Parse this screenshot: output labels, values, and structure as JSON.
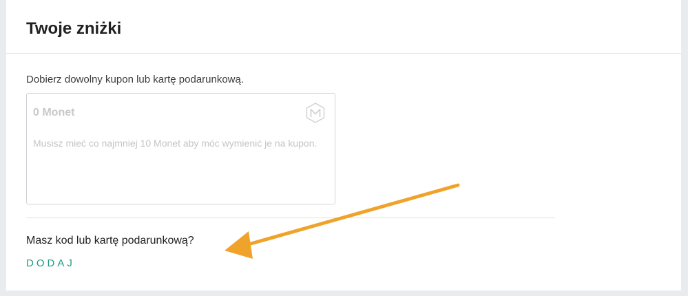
{
  "panel": {
    "title": "Twoje zniżki",
    "hint": "Dobierz dowolny kupon lub kartę podarunkową."
  },
  "coupon": {
    "amount": "0 Monet",
    "logo_icon": "monet-hexagon-icon",
    "description": "Musisz mieć co najmniej 10 Monet aby móc wymienić je na kupon."
  },
  "gift": {
    "question": "Masz kod lub kartę podarunkową?",
    "add_label": "DODAJ"
  },
  "colors": {
    "accent": "#1e9b82",
    "annotation_arrow": "#f0a32a"
  }
}
